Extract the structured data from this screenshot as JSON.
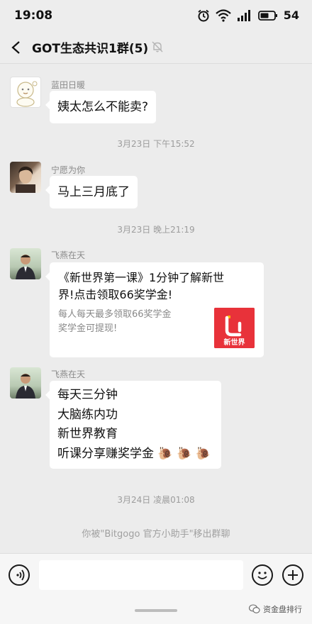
{
  "status_bar": {
    "time": "19:08",
    "battery": "54"
  },
  "header": {
    "title": "GOT生态共识1群(5)"
  },
  "messages": [
    {
      "sender": "蓝田日暖",
      "text": "姨太怎么不能卖?"
    },
    {
      "timestamp": "3月23日 下午15:52"
    },
    {
      "sender": "宁愿为你",
      "text": "马上三月底了"
    },
    {
      "timestamp": "3月23日 晚上21:19"
    },
    {
      "sender": "飞燕在天",
      "card": {
        "title": "《新世界第一课》1分钟了解新世界!点击领取66奖学金!",
        "title_lines": [
          "《新世界第一课》1分钟了解新世",
          "界!点击领取66奖学金!"
        ],
        "desc_lines": [
          "每人每天最多领取66奖学金",
          "奖学金可提现!"
        ],
        "logo_text": "新世界"
      }
    },
    {
      "sender": "飞燕在天",
      "lines": [
        "每天三分钟",
        "大脑练内功",
        "新世界教育",
        "听课分享赚奖学金"
      ]
    },
    {
      "timestamp": "3月24日 凌晨01:08"
    },
    {
      "system": "你被\"Bitgogo 官方小助手\"移出群聊"
    }
  ],
  "watermark": "资金盘排行",
  "colors": {
    "bubble": "#ffffff",
    "background": "#ececec",
    "card_logo": "#e8323a"
  },
  "icons": [
    "back-arrow-icon",
    "mute-bell-icon",
    "voice-icon",
    "emoji-icon",
    "plus-icon",
    "snail-emoji-icon"
  ]
}
